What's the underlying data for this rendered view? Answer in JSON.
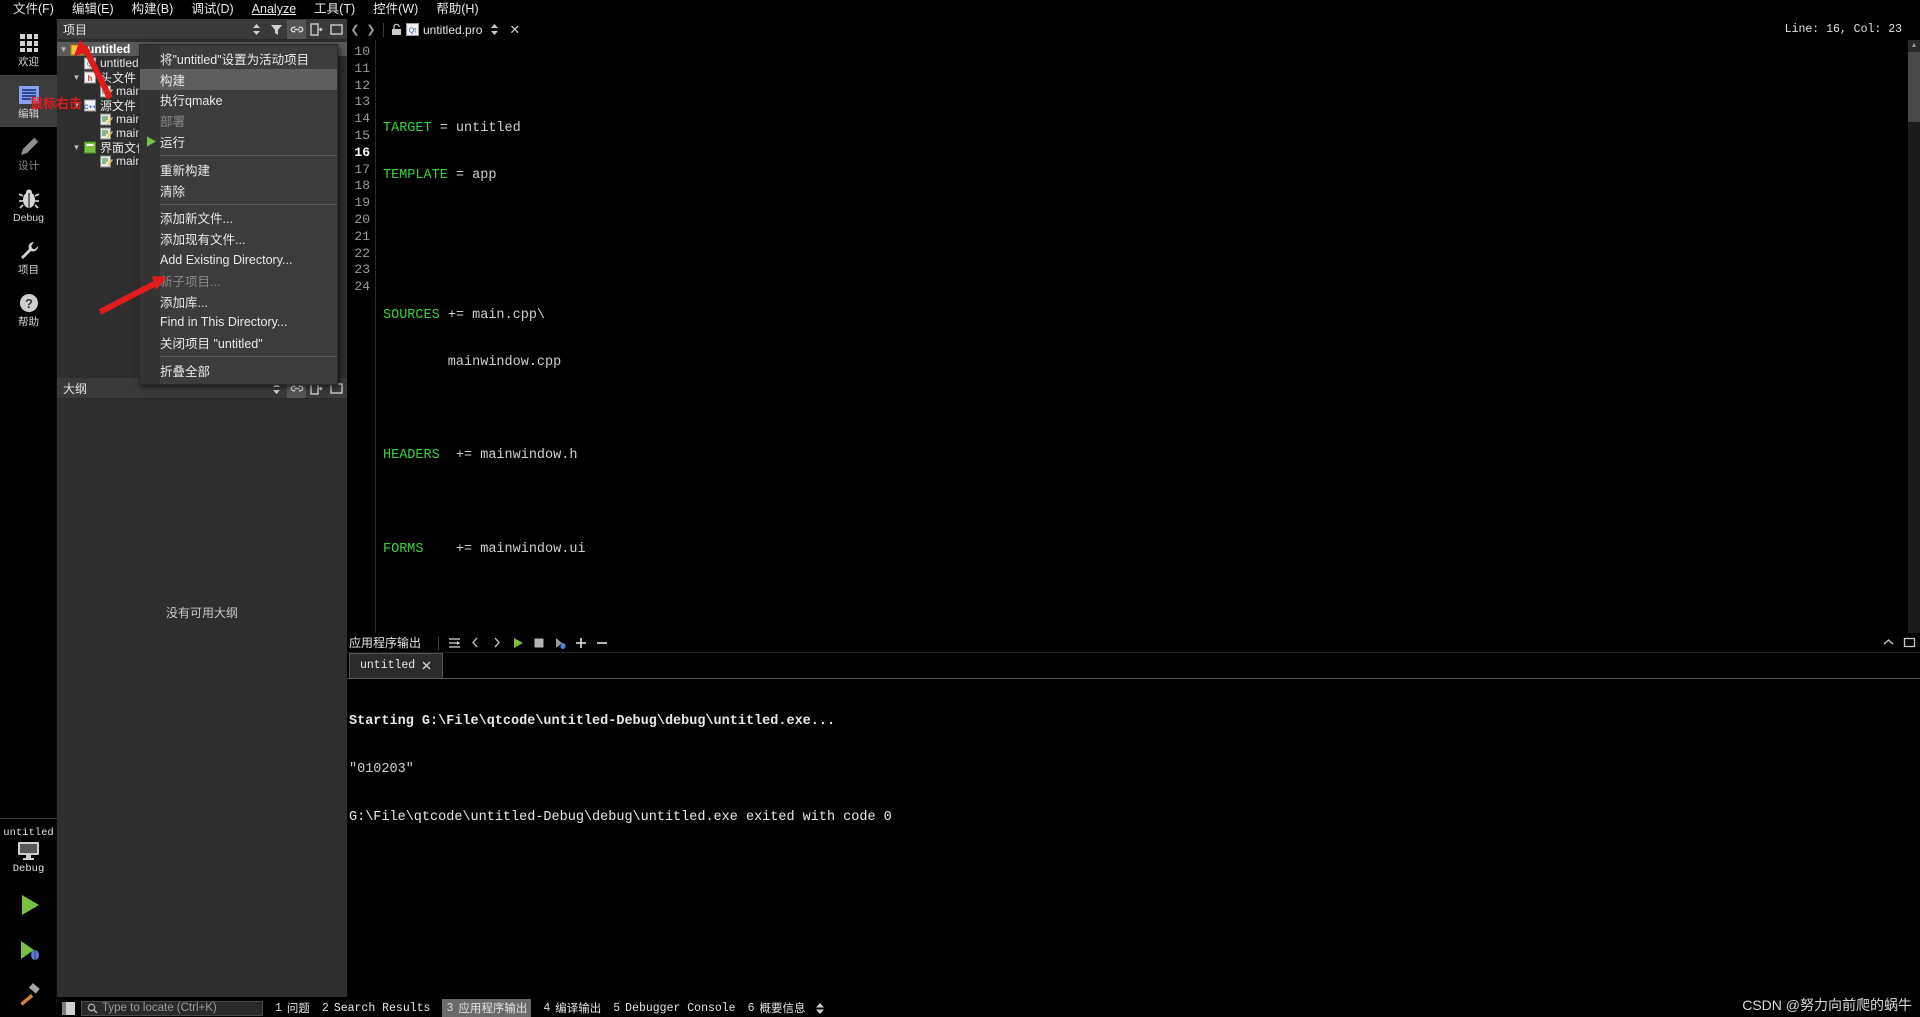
{
  "menubar": [
    {
      "label": "文件(F)",
      "mnemonic": "F"
    },
    {
      "label": "编辑(E)",
      "mnemonic": "E"
    },
    {
      "label": "构建(B)",
      "mnemonic": "B"
    },
    {
      "label": "调试(D)",
      "mnemonic": "D"
    },
    {
      "label": "Analyze",
      "mnemonic": "A"
    },
    {
      "label": "工具(T)",
      "mnemonic": "T"
    },
    {
      "label": "控件(W)",
      "mnemonic": "W"
    },
    {
      "label": "帮助(H)",
      "mnemonic": "H"
    }
  ],
  "modebar": {
    "items": [
      {
        "label": "欢迎",
        "icon": "grid-icon",
        "selected": false
      },
      {
        "label": "编辑",
        "icon": "edit-document-icon",
        "selected": true
      },
      {
        "label": "设计",
        "icon": "pencil-icon",
        "selected": false,
        "disabled": true
      },
      {
        "label": "Debug",
        "icon": "bug-icon",
        "selected": false
      },
      {
        "label": "项目",
        "icon": "wrench-icon",
        "selected": false
      },
      {
        "label": "帮助",
        "icon": "question-circle-icon",
        "selected": false
      }
    ],
    "kit": {
      "project": "untitled",
      "build_config": "Debug",
      "icon": "monitor-icon"
    },
    "actions": [
      {
        "name": "run-button",
        "icon": "green-play-icon"
      },
      {
        "name": "start-debugging-button",
        "icon": "play-bug-icon"
      },
      {
        "name": "build-button",
        "icon": "hammer-icon"
      }
    ]
  },
  "sidepane": {
    "header": {
      "title": "项目",
      "filter_icon": "filter-icon",
      "sync_icon": "link-icon",
      "expand_icon": "expand-all-icon",
      "close_icon": "close-pane-icon"
    },
    "tree": [
      {
        "label": "untitled",
        "depth": 0,
        "icon": "project-folder-icon",
        "arrow": "▼",
        "selected": true
      },
      {
        "label": "untitled.pro",
        "depth": 1,
        "icon": "pro-file-icon",
        "arrow": ""
      },
      {
        "label": "头文件",
        "depth": 1,
        "icon": "header-group-icon",
        "arrow": "▼"
      },
      {
        "label": "mainwindow.h",
        "depth": 2,
        "icon": "file-icon",
        "arrow": ""
      },
      {
        "label": "源文件",
        "depth": 1,
        "icon": "source-group-icon",
        "arrow": "▼"
      },
      {
        "label": "main.cpp",
        "depth": 2,
        "icon": "file-icon",
        "arrow": ""
      },
      {
        "label": "mainwindow.cpp",
        "depth": 2,
        "icon": "file-icon",
        "arrow": ""
      },
      {
        "label": "界面文件",
        "depth": 1,
        "icon": "forms-group-icon",
        "arrow": "▼"
      },
      {
        "label": "mainwindow.ui",
        "depth": 2,
        "icon": "file-icon",
        "arrow": ""
      }
    ],
    "outline": {
      "title": "大纲",
      "empty_text": "没有可用大纲"
    }
  },
  "context_menu": {
    "items": [
      {
        "label": "将\"untitled\"设置为活动项目",
        "state": "normal"
      },
      {
        "label": "构建",
        "state": "highlighted"
      },
      {
        "label": "执行qmake",
        "state": "normal"
      },
      {
        "label": "部署",
        "state": "disabled"
      },
      {
        "label": "运行",
        "state": "normal",
        "icon": "green-play-icon"
      },
      {
        "separator": true
      },
      {
        "label": "重新构建",
        "state": "normal"
      },
      {
        "label": "清除",
        "state": "normal"
      },
      {
        "separator": true
      },
      {
        "label": "添加新文件...",
        "state": "normal"
      },
      {
        "label": "添加现有文件...",
        "state": "normal"
      },
      {
        "label": "Add Existing Directory...",
        "state": "normal"
      },
      {
        "label": "新子项目...",
        "state": "disabled"
      },
      {
        "label": "添加库...",
        "state": "normal"
      },
      {
        "label": "Find in This Directory...",
        "state": "normal"
      },
      {
        "label": "关闭项目 \"untitled\"",
        "state": "normal"
      },
      {
        "separator": true
      },
      {
        "label": "折叠全部",
        "state": "normal"
      }
    ]
  },
  "editor": {
    "tab": {
      "filename": "untitled.pro",
      "lock_icon": "unlocked-icon",
      "file_icon": "pro-file-icon",
      "close_icon": "close-icon"
    },
    "cursor_status": "Line: 16, Col: 23",
    "first_line_number": 10,
    "current_line": 16,
    "lines": [
      {
        "n": 10,
        "tokens": []
      },
      {
        "n": 11,
        "tokens": [
          {
            "t": "TARGET",
            "c": "kw"
          },
          {
            "t": " = untitled",
            "c": "pl"
          }
        ]
      },
      {
        "n": 12,
        "tokens": [
          {
            "t": "TEMPLATE",
            "c": "kw"
          },
          {
            "t": " = app",
            "c": "pl"
          }
        ]
      },
      {
        "n": 13,
        "tokens": []
      },
      {
        "n": 14,
        "tokens": []
      },
      {
        "n": 15,
        "tokens": [
          {
            "t": "SOURCES",
            "c": "kw"
          },
          {
            "t": " += main.cpp\\",
            "c": "pl"
          }
        ]
      },
      {
        "n": 16,
        "tokens": [
          {
            "t": "        mainwindow.cpp",
            "c": "pl"
          }
        ]
      },
      {
        "n": 17,
        "tokens": []
      },
      {
        "n": 18,
        "tokens": [
          {
            "t": "HEADERS",
            "c": "kw"
          },
          {
            "t": "  += mainwindow.h",
            "c": "pl"
          }
        ]
      },
      {
        "n": 19,
        "tokens": []
      },
      {
        "n": 20,
        "tokens": [
          {
            "t": "FORMS",
            "c": "kw"
          },
          {
            "t": "    += mainwindow.ui",
            "c": "pl"
          }
        ]
      },
      {
        "n": 21,
        "tokens": []
      },
      {
        "n": 22,
        "tokens": []
      },
      {
        "n": 23,
        "tokens": [],
        "caret": true
      },
      {
        "n": 24,
        "tokens": []
      }
    ]
  },
  "output_pane": {
    "title": "应用程序输出",
    "toolbar_icons": [
      "word-wrap-icon",
      "prev-item-icon",
      "next-item-icon",
      "run-icon",
      "stop-icon",
      "attach-icon",
      "zoom-in-icon",
      "zoom-out-icon"
    ],
    "collapse_icons": [
      "collapse-icon",
      "maximize-icon"
    ],
    "tab": {
      "label": "untitled",
      "close_icon": "close-run-icon"
    },
    "lines": [
      {
        "text": "Starting G:\\File\\qtcode\\untitled-Debug\\debug\\untitled.exe...",
        "bold": true
      },
      {
        "text": "\"010203\"",
        "bold": false
      },
      {
        "text": "G:\\File\\qtcode\\untitled-Debug\\debug\\untitled.exe exited with code 0",
        "bold": false
      }
    ]
  },
  "statusbar": {
    "locate_placeholder": "Type to locate (Ctrl+K)",
    "search_icon": "magnifier-icon",
    "panel_toggle_icon": "sidebar-toggle-icon",
    "tabs": [
      {
        "num": "1",
        "label": "问题",
        "active": false
      },
      {
        "num": "2",
        "label": "Search Results",
        "active": false
      },
      {
        "num": "3",
        "label": "应用程序输出",
        "active": true
      },
      {
        "num": "4",
        "label": "编译输出",
        "active": false
      },
      {
        "num": "5",
        "label": "Debugger Console",
        "active": false
      },
      {
        "num": "6",
        "label": "概要信息",
        "active": false
      }
    ]
  },
  "annotations": {
    "mouse_right_click_note": "鼠标右击",
    "watermark": "CSDN @努力向前爬的蜗牛"
  }
}
